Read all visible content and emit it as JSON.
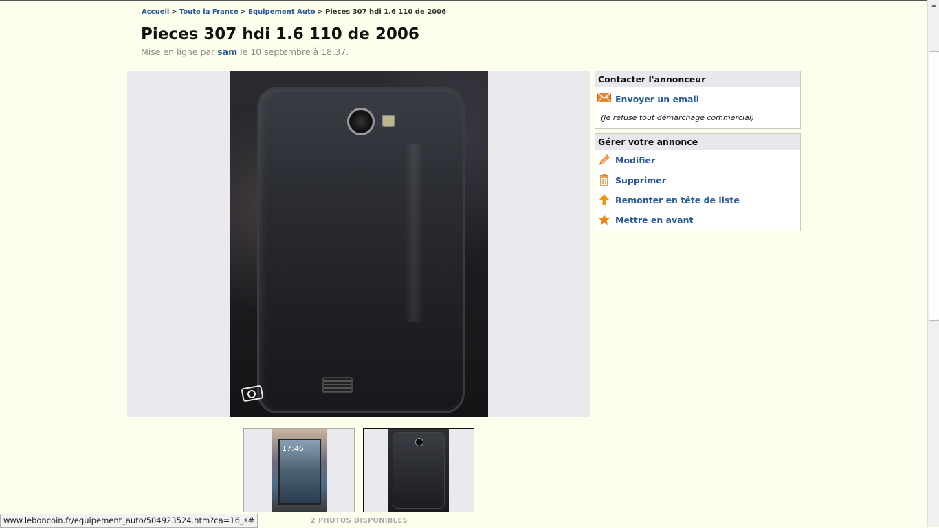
{
  "breadcrumb": {
    "items": [
      "Accueil",
      "Toute la France",
      "Equipement Auto"
    ],
    "current": "Pieces 307 hdi 1.6 110 de 2006",
    "separator": ">"
  },
  "ad": {
    "title": "Pieces 307 hdi 1.6 110 de 2006",
    "posted_prefix": "Mise en ligne par",
    "author": "sam",
    "posted_suffix": "le 10 septembre à 18:37."
  },
  "gallery": {
    "photos_count_label": "2 PHOTOS DISPONIBLES",
    "selected_index": 2,
    "thumb1_time": "17:46"
  },
  "contact_panel": {
    "title": "Contacter l'annonceur",
    "email_label": "Envoyer un email",
    "disclaimer": "(Je refuse tout démarchage commercial)"
  },
  "manage_panel": {
    "title": "Gérer votre annonce",
    "items": [
      "Modifier",
      "Supprimer",
      "Remonter en tête de liste",
      "Mettre en avant"
    ]
  },
  "status_bar": {
    "url": "www.leboncoin.fr/equipement_auto/504923524.htm?ca=16_s#"
  },
  "colors": {
    "background": "#fefeec",
    "link": "#2a5a9a",
    "icon_accent": "#e8842a"
  },
  "icons": [
    "envelope-icon",
    "pencil-icon",
    "trash-icon",
    "arrow-up-icon",
    "star-icon",
    "camera-watermark-icon"
  ]
}
